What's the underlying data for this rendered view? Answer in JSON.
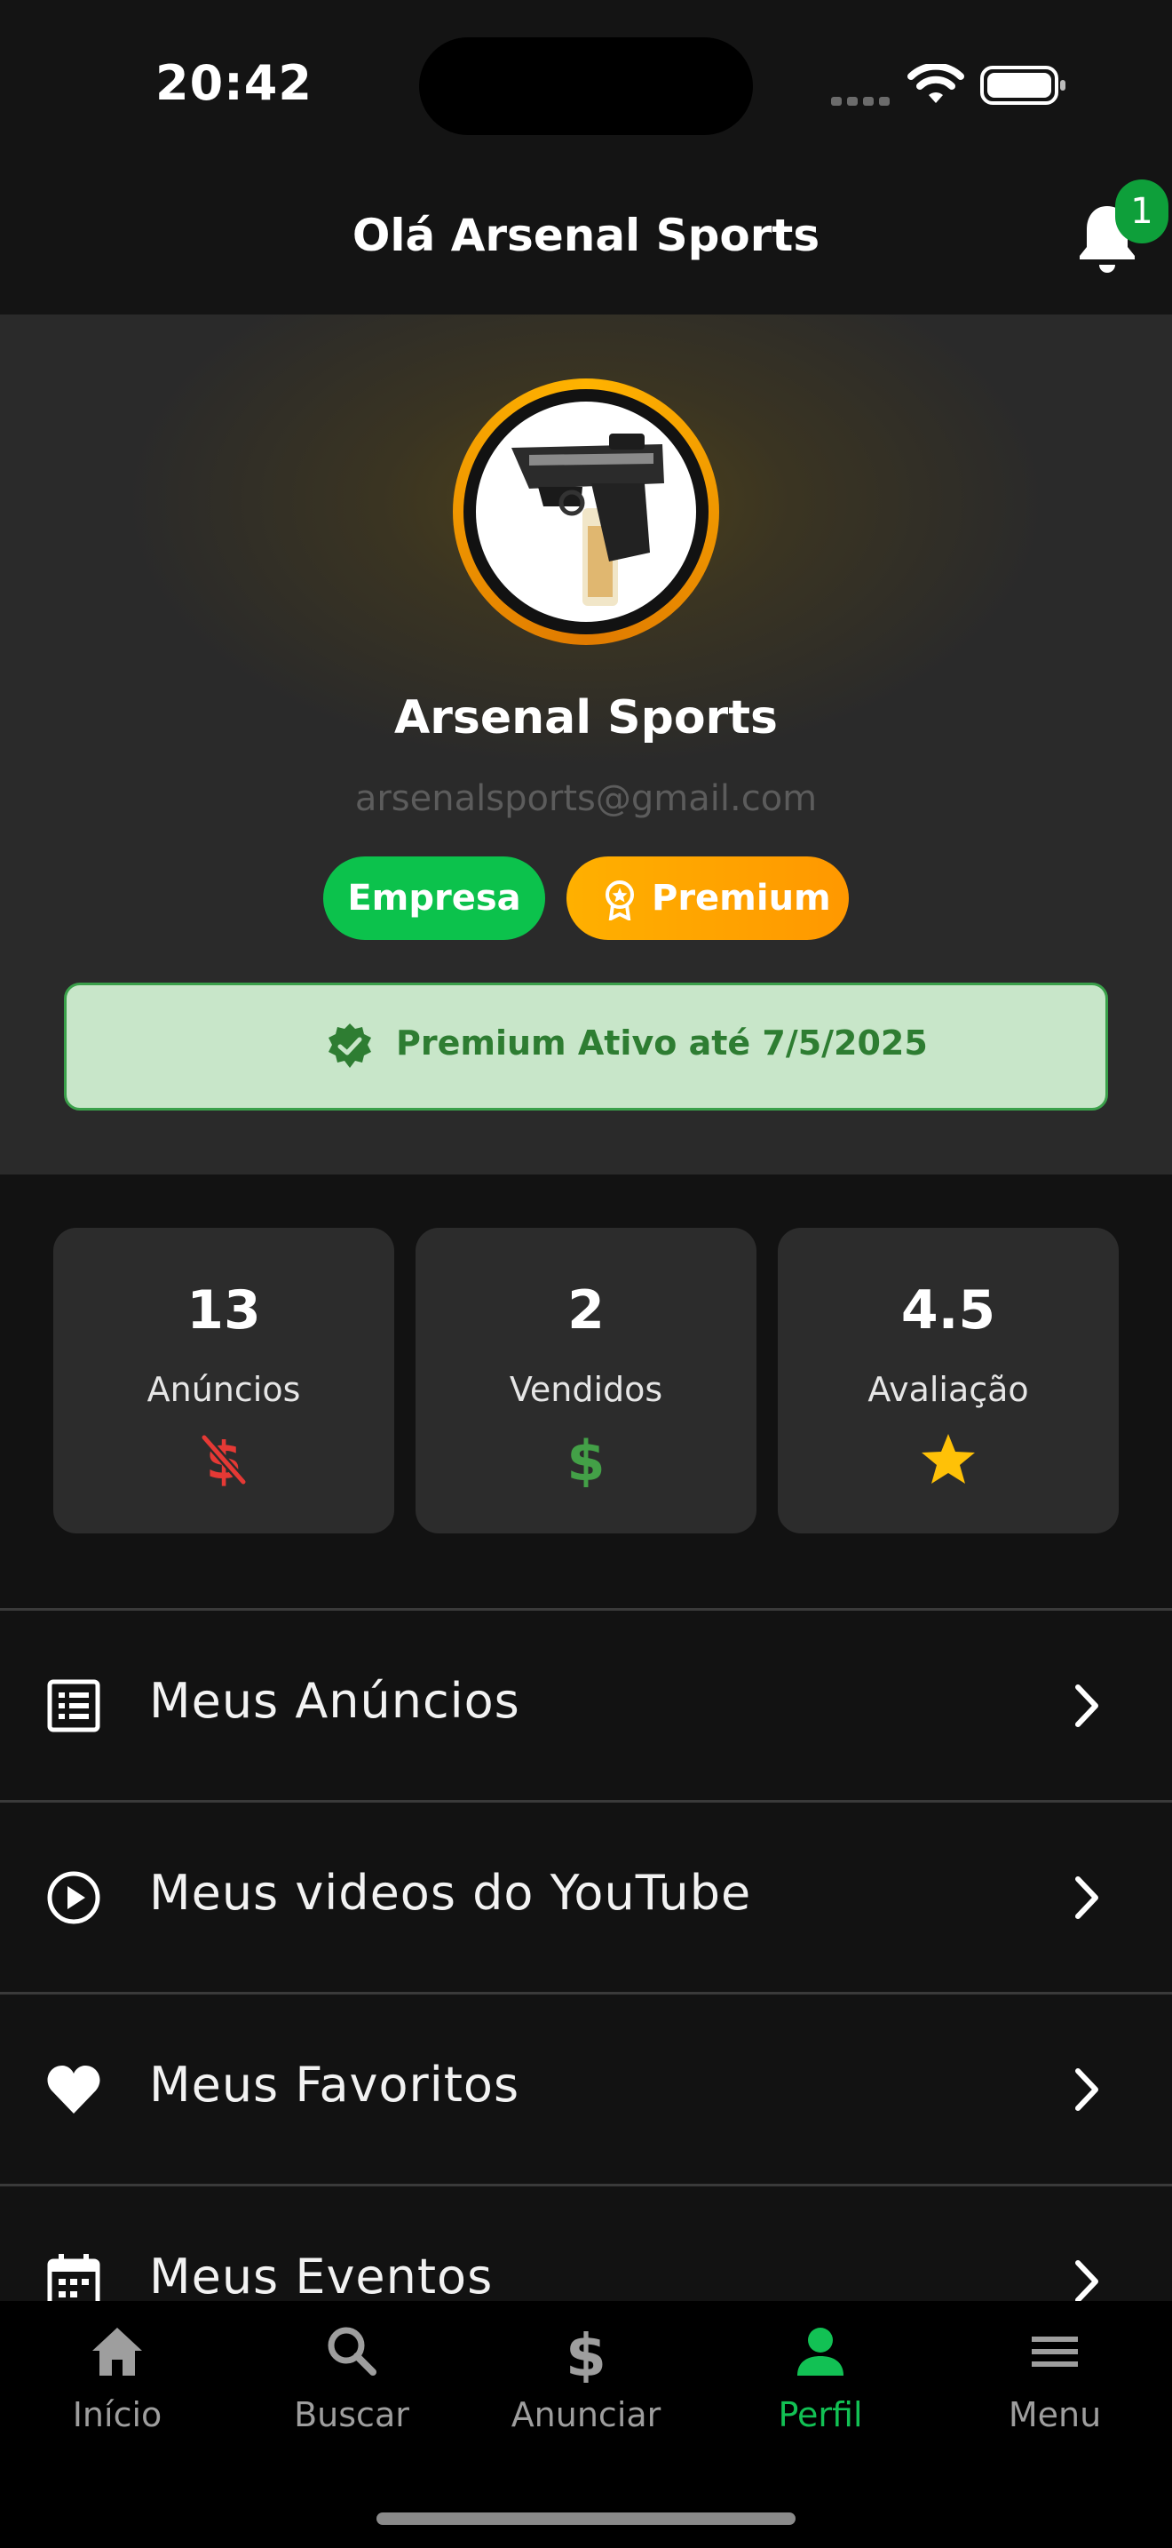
{
  "status_bar": {
    "time": "20:42"
  },
  "header": {
    "greeting": "Olá Arsenal Sports",
    "notification_count": "1"
  },
  "profile": {
    "name": "Arsenal Sports",
    "email": "arsenalsports@gmail.com",
    "badges": {
      "empresa": "Empresa",
      "premium": "Premium"
    },
    "premium_status": "Premium Ativo até 7/5/2025"
  },
  "stats": [
    {
      "value": "13",
      "label": "Anúncios",
      "icon": "money-off-icon",
      "icon_color": "#e53935"
    },
    {
      "value": "2",
      "label": "Vendidos",
      "icon": "dollar-icon",
      "icon_color": "#43a047"
    },
    {
      "value": "4.5",
      "label": "Avaliação",
      "icon": "star-icon",
      "icon_color": "#ffc107"
    }
  ],
  "menu": [
    {
      "label": "Meus Anúncios",
      "icon": "list-alt-icon"
    },
    {
      "label": "Meus videos do YouTube",
      "icon": "play-circle-icon"
    },
    {
      "label": "Meus Favoritos",
      "icon": "heart-icon"
    },
    {
      "label": "Meus Eventos",
      "icon": "calendar-icon"
    }
  ],
  "tabs": [
    {
      "label": "Início",
      "icon": "home-icon"
    },
    {
      "label": "Buscar",
      "icon": "search-icon"
    },
    {
      "label": "Anunciar",
      "icon": "dollar-icon"
    },
    {
      "label": "Perfil",
      "icon": "person-icon",
      "active": true
    },
    {
      "label": "Menu",
      "icon": "menu-icon"
    }
  ],
  "colors": {
    "background": "#121212",
    "accent_green": "#12c154",
    "premium_orange": "#ffa000",
    "premium_banner_bg": "#c8e6c9",
    "premium_banner_text": "#2e7d32"
  }
}
